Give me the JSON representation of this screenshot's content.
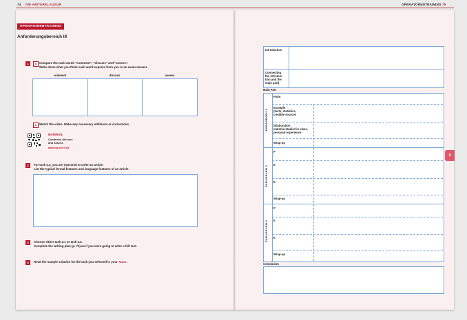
{
  "header": {
    "left_page_number": "74",
    "left_title": "DIE ABITURKLAUSUR",
    "right_title": "OPERATORENTRAINING",
    "right_page_number": "75"
  },
  "left": {
    "pill": "OPERATORENTRAINING",
    "heading": "Anforderungsbereich III",
    "task1": {
      "number": "1",
      "a_letter": "a",
      "a_line1": "Compare the task words \"comment\", \"discuss\" and \"assess\".",
      "a_line2": "Write down what you think each word expects from you in an exam answer.",
      "columns": [
        "comment",
        "discuss",
        "assess"
      ],
      "b_letter": "b",
      "b_text": "Watch the video. Make any necessary additions or corrections.",
      "material_title": "MATERIAL",
      "material_sub1": "Comment, discuss",
      "material_sub2": "and assess",
      "material_link": "abiturvp.de/n7ru5"
    },
    "task2": {
      "number": "2",
      "line1": "For task 3.2, you are expected to write an article.",
      "line2": "List the typical formal features and language features of an article."
    },
    "task3": {
      "number": "3",
      "line1": "Choose either task 3.1 or task 3.2.",
      "line2": "Complete the writing plan (p. 75) as if you were going to write a full text."
    },
    "task4": {
      "number": "4",
      "text": "Read the sample solution for the task you selected in your",
      "brand": "Abitur",
      "end": "."
    }
  },
  "right": {
    "introduction": "Introduction",
    "connecting": [
      "Connecting",
      "the introduc-",
      "tion and the",
      "main part)"
    ],
    "main_part": "Main Part",
    "paragraph1_label": "PARAGRAPH 1",
    "paragraph2_label": "PARAGRAPH 2",
    "paragraph3_label": "PARAGRAPH 3",
    "p1_point": "Point",
    "p1_example": [
      "Example",
      "(facts, statistics,",
      "credible sources"
    ],
    "p1_elaboration": [
      "(Elaboration",
      "material studied in class,",
      "personal experience"
    ],
    "p1_wrapup": "Wrap-up",
    "p2_rows": [
      "P",
      "E",
      "E",
      "Wrap-up"
    ],
    "p3_rows": [
      "P",
      "E",
      "E",
      "Wrap-up"
    ],
    "conclusion": "Conclusion",
    "tab": "II"
  },
  "colors": {
    "accent": "#b8182d",
    "grid": "#7aa7d8",
    "page": "#faf0f0"
  }
}
